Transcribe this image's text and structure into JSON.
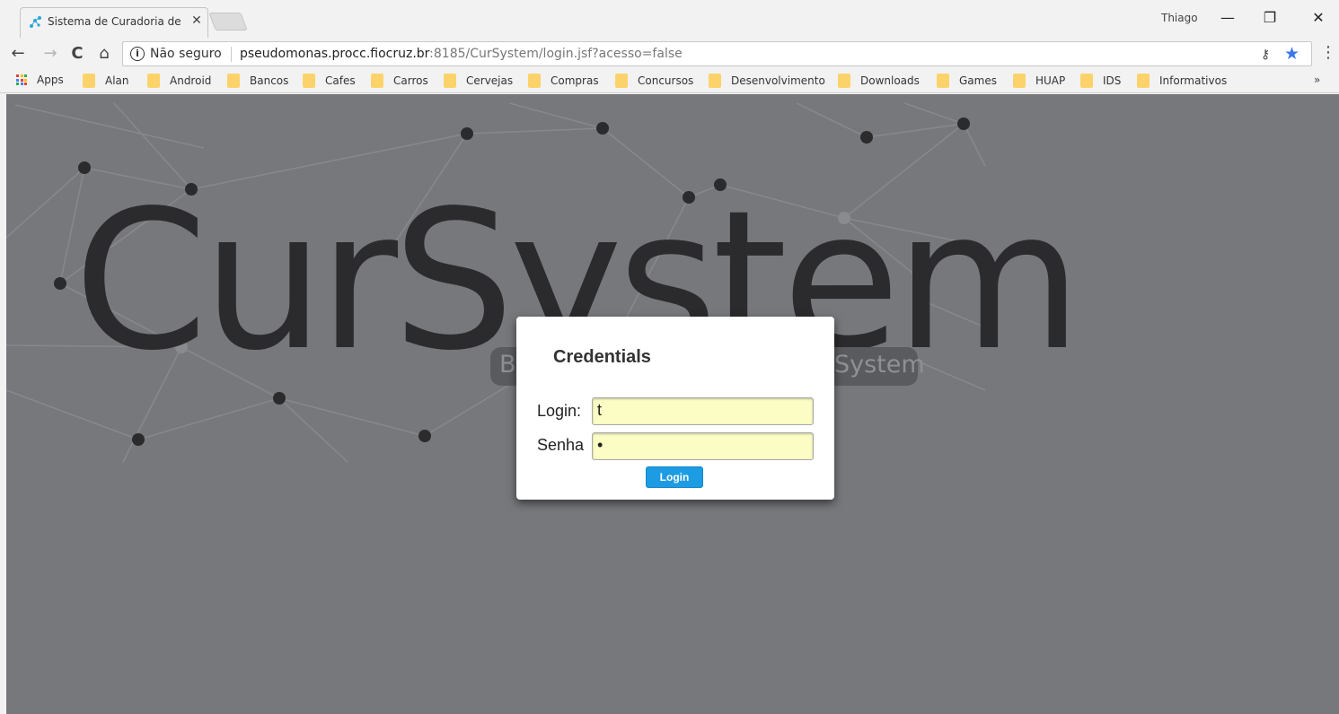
{
  "browser": {
    "tab_title": "Sistema de Curadoria de",
    "tab_close": "✕",
    "profile_name": "Thiago",
    "window_buttons": {
      "minimize": "—",
      "restore": "❐",
      "close": "✕"
    },
    "nav": {
      "back": "←",
      "forward": "→",
      "reload": "C",
      "home": "⌂"
    },
    "security_text": "Não seguro",
    "info_glyph": "i",
    "url_host": "pseudomonas.procc.fiocruz.br",
    "url_rest": ":8185/CurSystem/login.jsf?acesso=false",
    "star_color": "#3b78e7",
    "bookmarks": {
      "apps": "Apps",
      "folders": [
        "Alan",
        "Android",
        "Bancos",
        "Cafes",
        "Carros",
        "Cervejas",
        "Compras",
        "Concursos",
        "Desenvolvimento",
        "Downloads",
        "Games",
        "HUAP",
        "IDS",
        "Informativos"
      ],
      "more": "»"
    }
  },
  "page": {
    "brand": "CurSystem",
    "tagline_left": "B",
    "tagline_right": "System",
    "background_color": "#77787c"
  },
  "login_dialog": {
    "title": "Credentials",
    "login_label": "Login:",
    "login_value": "t",
    "password_label": "Senha",
    "password_value": "•",
    "submit_label": "Login",
    "button_color": "#1d9ce3",
    "input_bg": "#fbfdc4"
  }
}
